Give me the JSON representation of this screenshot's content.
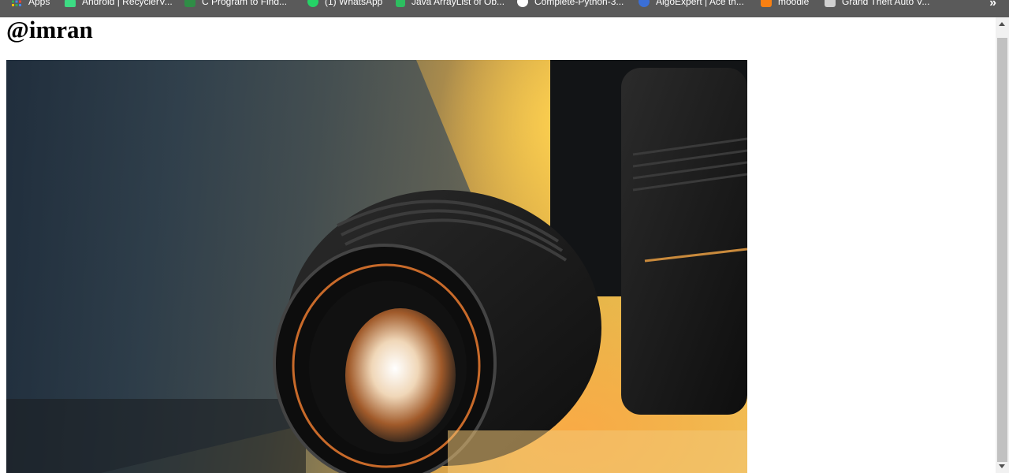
{
  "bookmarks": {
    "items": [
      {
        "label": "Apps",
        "icon": "apps-grid-icon"
      },
      {
        "label": "Android | RecyclerV...",
        "icon": "android-icon"
      },
      {
        "label": "C Program to Find...",
        "icon": "site-icon"
      },
      {
        "label": "(1) WhatsApp",
        "icon": "whatsapp-icon"
      },
      {
        "label": "Java ArrayList of Ob...",
        "icon": "b-icon"
      },
      {
        "label": "Complete-Python-3...",
        "icon": "github-icon"
      },
      {
        "label": "AlgoExpert | Ace th...",
        "icon": "algoexpert-icon"
      },
      {
        "label": "moodle",
        "icon": "moodle-icon"
      },
      {
        "label": "Grand Theft Auto V...",
        "icon": "game-icon"
      }
    ],
    "overflow_label": "»"
  },
  "page": {
    "heading": "@imran"
  },
  "hero_image": {
    "description_icon": "camera-lens-photo"
  }
}
